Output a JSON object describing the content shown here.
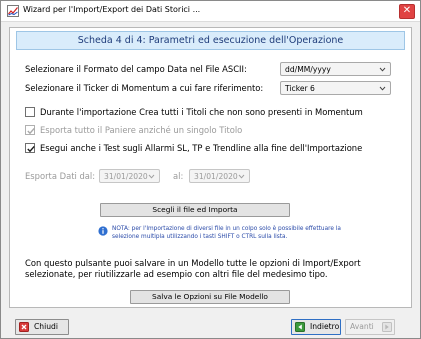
{
  "window": {
    "title": "Wizard per l'Import/Export dei Dati Storici ...",
    "close_glyph": "✕"
  },
  "banner": {
    "text": "Scheda 4 di 4:   Parametri ed esecuzione dell'Operazione"
  },
  "fields": {
    "date_format_label": "Selezionare il Formato del campo Data nel File ASCII:",
    "date_format_value": "dd/MM/yyyy",
    "ticker_label": "Selezionare il Ticker di Momentum a cui fare riferimento:",
    "ticker_value": "Ticker 6"
  },
  "options": {
    "create_titles_label": "Durante l'importazione Crea tutti i Titoli che non sono presenti in Momentum",
    "create_titles_checked": false,
    "export_basket_label": "Esporta tutto il Paniere anziché un singolo Titolo",
    "export_basket_checked": true,
    "export_basket_enabled": false,
    "run_tests_label": "Esegui anche i Test sugli Allarmi SL, TP e Trendline alla fine dell'Importazione",
    "run_tests_checked": true
  },
  "export_range": {
    "from_label": "Esporta Dati dal:",
    "from_value": "31/01/2020",
    "to_label": "al:",
    "to_value": "31/01/2020"
  },
  "import_button": {
    "label": "Scegli il file ed Importa"
  },
  "note": {
    "text": "NOTA:  per l'Importazione di diversi file in un colpo solo è possibile effettuare la selezione multipla utilizzando i tasti SHIFT o CTRL sulla lista."
  },
  "model": {
    "description": "Con questo pulsante puoi salvare in un Modello tutte le opzioni di Import/Export selezionate, per riutilizzarle ad esempio con altri file del medesimo tipo.",
    "save_label": "Salva le Opzioni su File Modello"
  },
  "footer": {
    "close_label": "Chiudi",
    "back_label": "Indietro",
    "next_label": "Avanti"
  },
  "colors": {
    "banner_bg": "#d9ecfb",
    "banner_text": "#1f3c7a",
    "note_text": "#2a4aa8",
    "disabled_text": "#9a9a9a"
  }
}
